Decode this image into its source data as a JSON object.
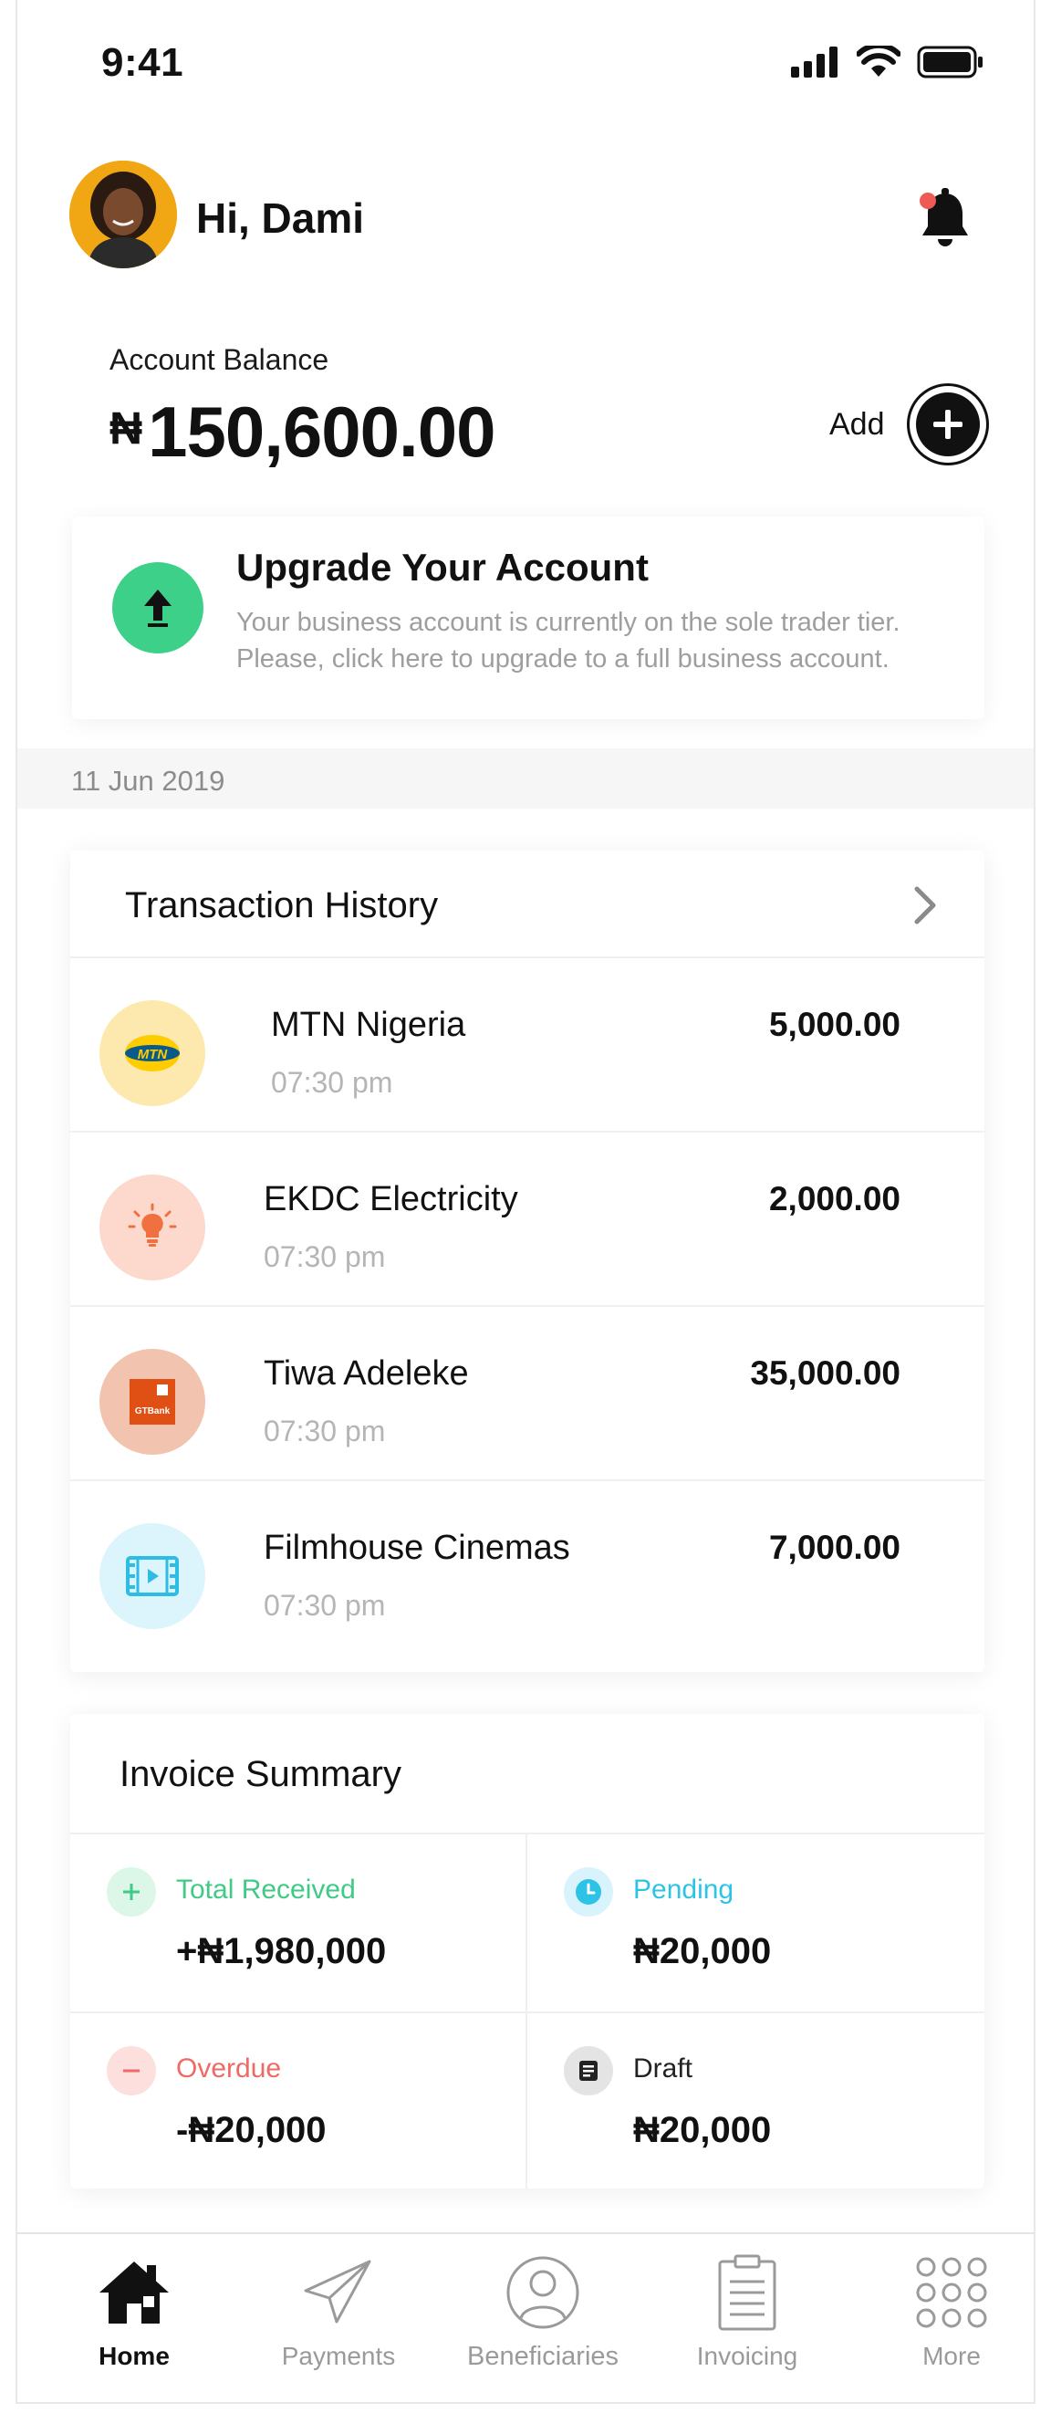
{
  "status_bar": {
    "time": "9:41",
    "icons": [
      "signal-icon",
      "wifi-icon",
      "battery-icon"
    ]
  },
  "header": {
    "greeting": "Hi, Dami",
    "avatar": "avatar",
    "notification_icon": "bell-icon",
    "has_notification": true
  },
  "balance": {
    "label": "Account Balance",
    "currency": "₦",
    "amount": "150,600.00",
    "add_label": "Add"
  },
  "upgrade": {
    "title": "Upgrade Your Account",
    "description": "Your business account is currently on the sole trader tier. Please, click here to upgrade to a full business account.",
    "icon": "arrow-up-icon"
  },
  "date": "11 Jun 2019",
  "transactions": {
    "title": "Transaction History",
    "items": [
      {
        "name": "MTN Nigeria",
        "time": "07:30 pm",
        "amount": "5,000.00",
        "icon": "mtn-logo",
        "icon_bg": "#fde9ad"
      },
      {
        "name": "EKDC Electricity",
        "time": "07:30 pm",
        "amount": "2,000.00",
        "icon": "lightbulb-icon",
        "icon_bg": "#fcd9cc"
      },
      {
        "name": "Tiwa Adeleke",
        "time": "07:30 pm",
        "amount": "35,000.00",
        "icon": "gtbank-logo",
        "icon_bg": "#f2c3af"
      },
      {
        "name": "Filmhouse Cinemas",
        "time": "07:30 pm",
        "amount": "7,000.00",
        "icon": "film-icon",
        "icon_bg": "#dcf4fc"
      }
    ]
  },
  "invoice": {
    "title": "Invoice Summary",
    "cells": [
      {
        "label": "Total Received",
        "value": "+₦1,980,000",
        "color": "#3fcb85",
        "icon": "plus-icon"
      },
      {
        "label": "Pending",
        "value": "₦20,000",
        "color": "#2dc3e6",
        "icon": "clock-icon"
      },
      {
        "label": "Overdue",
        "value": "-₦20,000",
        "color": "#ef6a64",
        "icon": "minus-icon"
      },
      {
        "label": "Draft",
        "value": "₦20,000",
        "color": "#222222",
        "icon": "document-icon"
      }
    ],
    "mtn_logo_text": "MTN",
    "gtbank_logo_text": "GTBank"
  },
  "nav": {
    "items": [
      {
        "label": "Home",
        "icon": "home-icon",
        "active": true
      },
      {
        "label": "Payments",
        "icon": "paper-plane-icon",
        "active": false
      },
      {
        "label": "Beneficiaries",
        "icon": "user-circle-icon",
        "active": false
      },
      {
        "label": "Invoicing",
        "icon": "clipboard-icon",
        "active": false
      },
      {
        "label": "More",
        "icon": "grid-dots-icon",
        "active": false
      }
    ]
  },
  "colors": {
    "accent_green": "#3dd088",
    "text_primary": "#111111",
    "text_muted": "#9e9e9e"
  }
}
